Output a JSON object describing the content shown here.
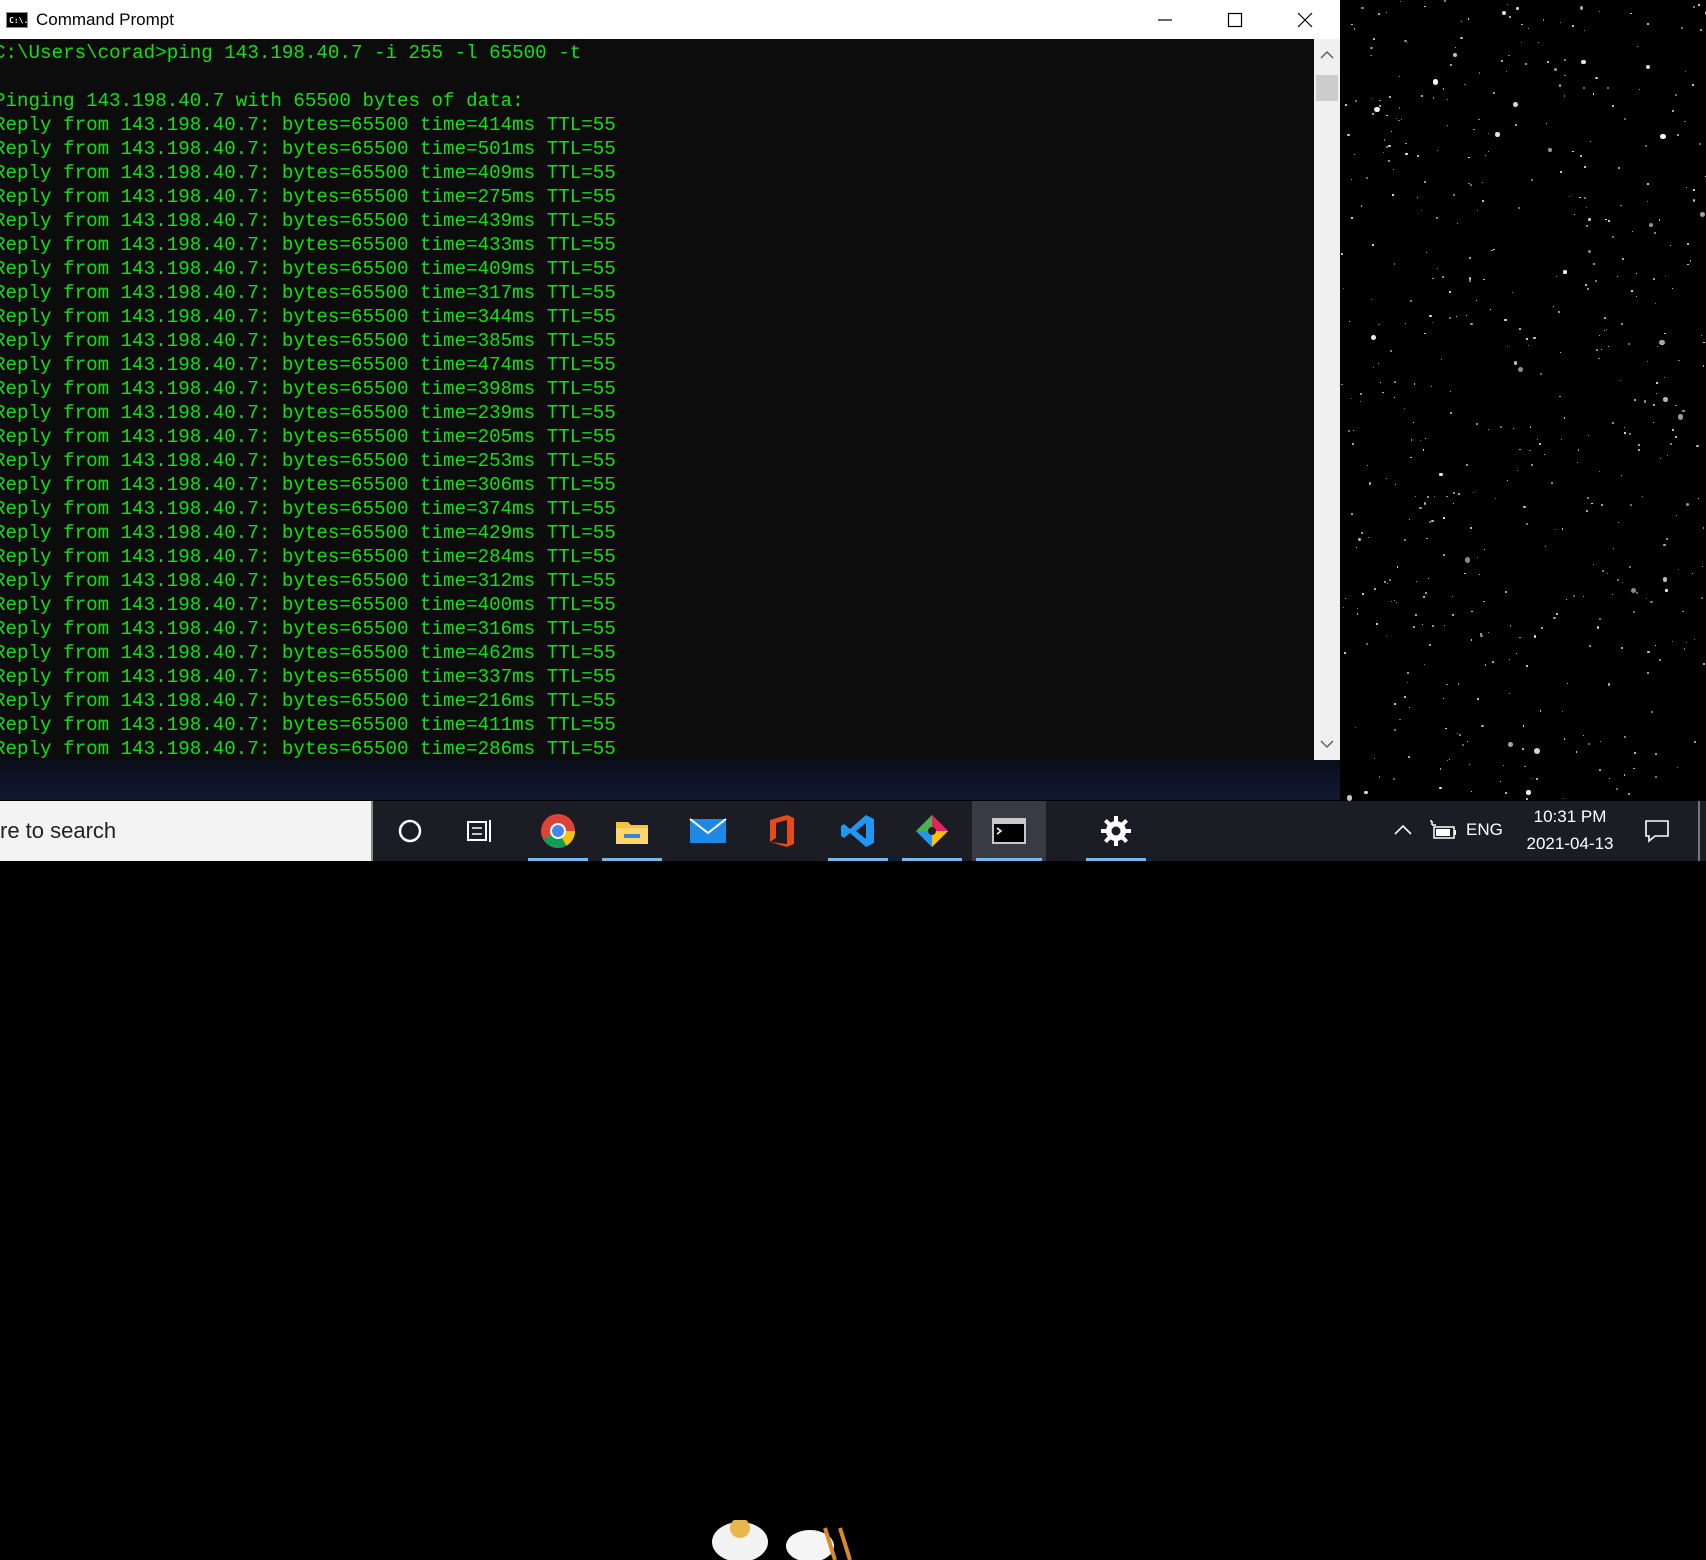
{
  "window": {
    "title": "Command Prompt",
    "icon": "cmd-icon",
    "icon_text": "C:\\."
  },
  "console": {
    "lines": [
      "C:\\Users\\corad>ping 143.198.40.7 -i 255 -l 65500 -t",
      "",
      "Pinging 143.198.40.7 with 65500 bytes of data:",
      "Reply from 143.198.40.7: bytes=65500 time=414ms TTL=55",
      "Reply from 143.198.40.7: bytes=65500 time=501ms TTL=55",
      "Reply from 143.198.40.7: bytes=65500 time=409ms TTL=55",
      "Reply from 143.198.40.7: bytes=65500 time=275ms TTL=55",
      "Reply from 143.198.40.7: bytes=65500 time=439ms TTL=55",
      "Reply from 143.198.40.7: bytes=65500 time=433ms TTL=55",
      "Reply from 143.198.40.7: bytes=65500 time=409ms TTL=55",
      "Reply from 143.198.40.7: bytes=65500 time=317ms TTL=55",
      "Reply from 143.198.40.7: bytes=65500 time=344ms TTL=55",
      "Reply from 143.198.40.7: bytes=65500 time=385ms TTL=55",
      "Reply from 143.198.40.7: bytes=65500 time=474ms TTL=55",
      "Reply from 143.198.40.7: bytes=65500 time=398ms TTL=55",
      "Reply from 143.198.40.7: bytes=65500 time=239ms TTL=55",
      "Reply from 143.198.40.7: bytes=65500 time=205ms TTL=55",
      "Reply from 143.198.40.7: bytes=65500 time=253ms TTL=55",
      "Reply from 143.198.40.7: bytes=65500 time=306ms TTL=55",
      "Reply from 143.198.40.7: bytes=65500 time=374ms TTL=55",
      "Reply from 143.198.40.7: bytes=65500 time=429ms TTL=55",
      "Reply from 143.198.40.7: bytes=65500 time=284ms TTL=55",
      "Reply from 143.198.40.7: bytes=65500 time=312ms TTL=55",
      "Reply from 143.198.40.7: bytes=65500 time=400ms TTL=55",
      "Reply from 143.198.40.7: bytes=65500 time=316ms TTL=55",
      "Reply from 143.198.40.7: bytes=65500 time=462ms TTL=55",
      "Reply from 143.198.40.7: bytes=65500 time=337ms TTL=55",
      "Reply from 143.198.40.7: bytes=65500 time=216ms TTL=55",
      "Reply from 143.198.40.7: bytes=65500 time=411ms TTL=55",
      "Reply from 143.198.40.7: bytes=65500 time=286ms TTL=55"
    ],
    "text_color": "#13e013",
    "background": "#0c0c0c"
  },
  "taskbar": {
    "search_text": "re to search",
    "pinned": [
      {
        "name": "cortana-icon",
        "running": false
      },
      {
        "name": "task-view-icon",
        "running": false
      },
      {
        "name": "chrome-icon",
        "running": true
      },
      {
        "name": "file-explorer-icon",
        "running": true
      },
      {
        "name": "mail-icon",
        "running": false
      },
      {
        "name": "office-icon",
        "running": false
      },
      {
        "name": "vscode-icon",
        "running": true
      },
      {
        "name": "git-icon",
        "running": true
      },
      {
        "name": "command-prompt-icon",
        "running": true,
        "active": true
      },
      {
        "name": "settings-gear-icon",
        "running": true
      }
    ],
    "tray": {
      "language": "ENG",
      "time": "10:31 PM",
      "date": "2021-04-13"
    },
    "accent": "#76b9ed"
  }
}
